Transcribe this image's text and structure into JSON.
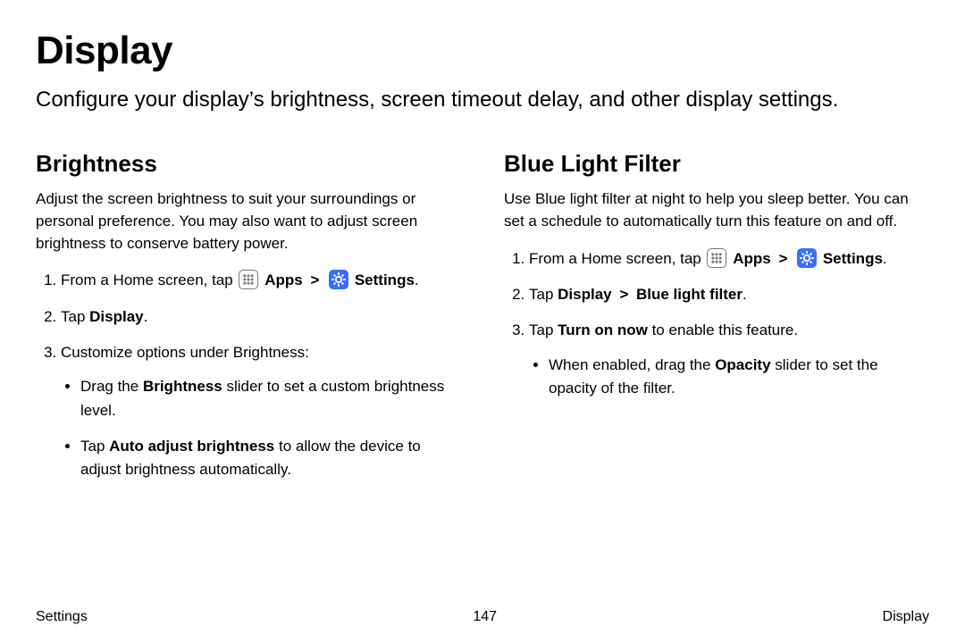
{
  "title": "Display",
  "intro": "Configure your display’s brightness, screen timeout delay, and other display settings.",
  "left": {
    "heading": "Brightness",
    "desc": "Adjust the screen brightness to suit your surroundings or personal preference. You may also want to adjust screen brightness to conserve battery power.",
    "step1_pre": "From a Home screen, tap ",
    "apps": "Apps",
    "settings": "Settings",
    "period": ".",
    "step2_pre": "Tap ",
    "step2_bold": "Display",
    "step3": "Customize options under Brightness:",
    "bullet1_pre": "Drag the ",
    "bullet1_bold": "Brightness",
    "bullet1_post": " slider to set a custom brightness level.",
    "bullet2_pre": "Tap ",
    "bullet2_bold": "Auto adjust brightness",
    "bullet2_post": " to allow the device to adjust brightness automatically."
  },
  "right": {
    "heading": "Blue Light Filter",
    "desc": "Use Blue light filter at night to help you sleep better. You can set a schedule to automatically turn this feature on and off.",
    "step1_pre": "From a Home screen, tap ",
    "apps": "Apps",
    "settings": "Settings",
    "period": ".",
    "step2_pre": "Tap ",
    "step2_b1": "Display",
    "step2_chev": " > ",
    "step2_b2": "Blue light filter",
    "step3_pre": "Tap ",
    "step3_bold": "Turn on now",
    "step3_post": " to enable this feature.",
    "bullet1_pre": "When enabled, drag the ",
    "bullet1_bold": "Opacity",
    "bullet1_post": " slider to set the opacity of the filter."
  },
  "footer": {
    "left": "Settings",
    "center": "147",
    "right": "Display"
  },
  "chevron": ">"
}
